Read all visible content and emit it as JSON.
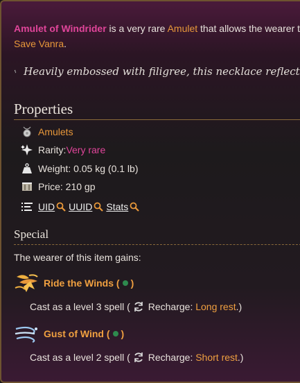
{
  "intro": {
    "item_name": "Amulet of Windrider",
    "text_a": " is a very rare ",
    "type_link": "Amulet",
    "text_b": " that allows the wearer to",
    "location_link": "Save Vanra",
    "text_c": "."
  },
  "flavor": "Heavily embossed with filigree, this necklace reflects light",
  "properties": {
    "heading": "Properties",
    "category": "Amulets",
    "rarity_label": "Rarity: ",
    "rarity_value": "Very rare",
    "weight": "Weight: 0.05 kg (0.1 lb)",
    "price": "Price: 210 gp",
    "links": [
      "UID",
      "UUID",
      "Stats"
    ]
  },
  "special": {
    "heading": "Special",
    "intro": "The wearer of this item gains:",
    "spells": [
      {
        "name": "Ride the Winds",
        "cast_prefix": "Cast as a level 3 spell (",
        "recharge_label": "Recharge: ",
        "recharge_value": "Long rest",
        "suffix": ".)"
      },
      {
        "name": "Gust of Wind",
        "cast_prefix": "Cast as a level 2 spell (",
        "recharge_label": "Recharge: ",
        "recharge_value": "Short rest",
        "suffix": ".)"
      }
    ]
  },
  "colors": {
    "accent_magenta": "#e0459a",
    "accent_orange": "#e8983a",
    "border_gold": "#6e5330"
  }
}
